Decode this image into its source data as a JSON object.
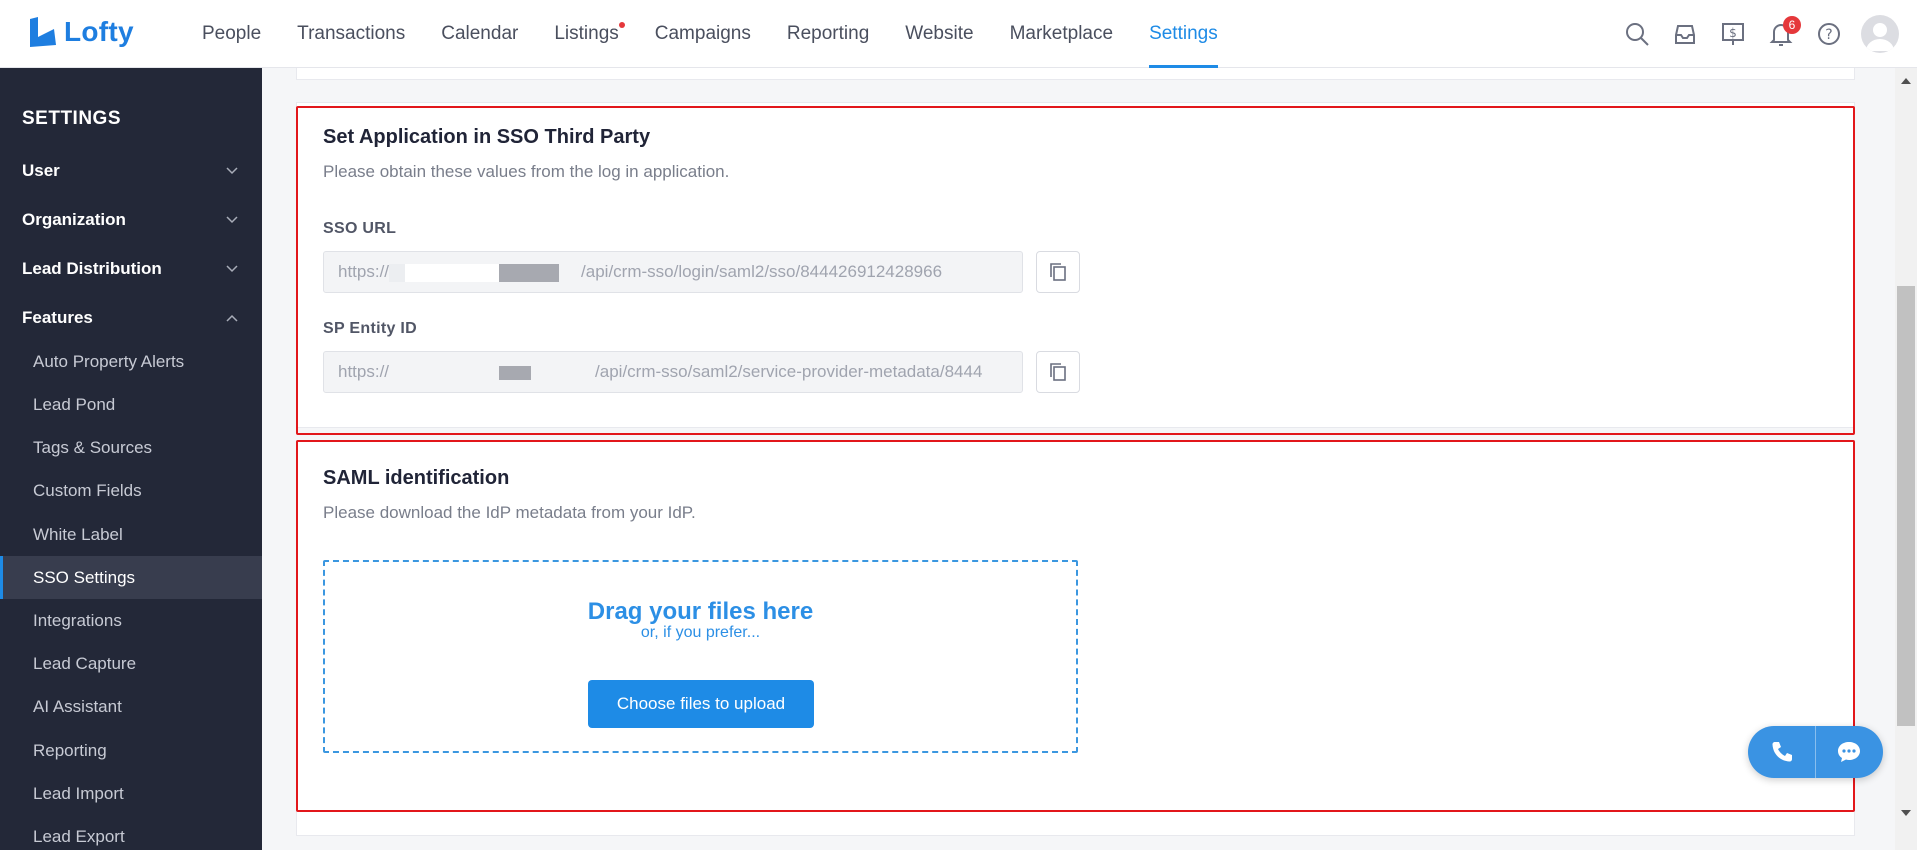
{
  "brand": {
    "name": "Lofty",
    "color": "#1e7ee0"
  },
  "nav": {
    "items": [
      {
        "label": "People"
      },
      {
        "label": "Transactions"
      },
      {
        "label": "Calendar"
      },
      {
        "label": "Listings",
        "dot": true
      },
      {
        "label": "Campaigns"
      },
      {
        "label": "Reporting"
      },
      {
        "label": "Website"
      },
      {
        "label": "Marketplace"
      },
      {
        "label": "Settings",
        "active": true
      }
    ],
    "icons": [
      "search-icon",
      "inbox-icon",
      "billing-icon",
      "bell-icon",
      "help-icon",
      "avatar"
    ],
    "notification_count": "6"
  },
  "sidebar": {
    "title": "SETTINGS",
    "groups": [
      {
        "label": "User",
        "expanded": false
      },
      {
        "label": "Organization",
        "expanded": false
      },
      {
        "label": "Lead Distribution",
        "expanded": false
      },
      {
        "label": "Features",
        "expanded": true
      }
    ],
    "items": [
      {
        "label": "Auto Property Alerts"
      },
      {
        "label": "Lead Pond"
      },
      {
        "label": "Tags & Sources"
      },
      {
        "label": "Custom Fields"
      },
      {
        "label": "White Label"
      },
      {
        "label": "SSO Settings",
        "active": true
      },
      {
        "label": "Integrations"
      },
      {
        "label": "Lead Capture"
      },
      {
        "label": "AI Assistant"
      },
      {
        "label": "Reporting"
      },
      {
        "label": "Lead Import"
      },
      {
        "label": "Lead Export"
      }
    ]
  },
  "sso": {
    "title": "Set Application in SSO Third Party",
    "subtitle": "Please obtain these values from the log in application.",
    "sso_url": {
      "label": "SSO URL",
      "prefix": "https://",
      "suffix": "/api/crm-sso/login/saml2/sso/844426912428966"
    },
    "sp_entity_id": {
      "label": "SP Entity ID",
      "prefix": "https://",
      "suffix": "/api/crm-sso/saml2/service-provider-metadata/8444"
    }
  },
  "saml": {
    "title": "SAML identification",
    "subtitle": "Please download the IdP metadata from your IdP.",
    "dropzone": {
      "title": "Drag your files here",
      "subtitle": "or, if you prefer...",
      "button": "Choose files to upload"
    }
  },
  "floating_actions": [
    "phone-icon",
    "chat-icon"
  ],
  "colors": {
    "accent": "#1e8be6",
    "sidebar_bg": "#232838",
    "highlight": "#e2171b"
  }
}
